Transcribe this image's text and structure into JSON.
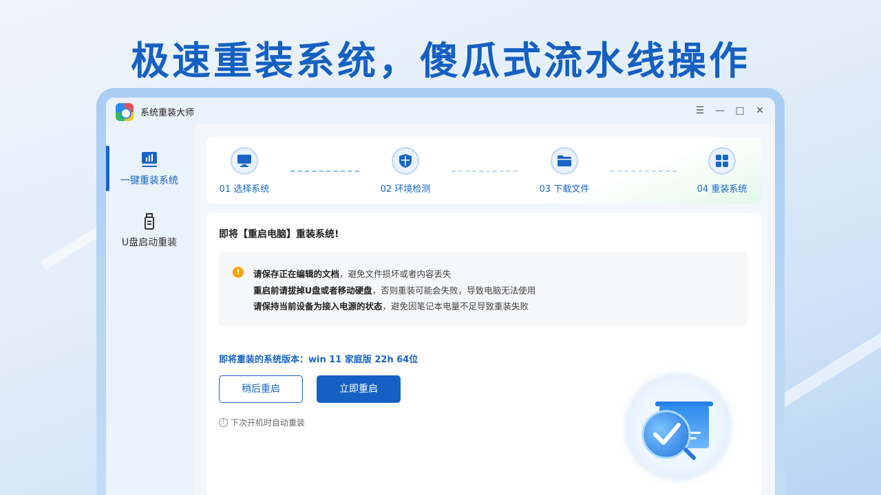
{
  "hero": {
    "title": "极速重装系统，傻瓜式流水线操作"
  },
  "app": {
    "title": "系统重装大师",
    "controls": {
      "menu": "☰",
      "minimize": "—",
      "maximize": "□",
      "close": "✕"
    }
  },
  "sidebar": {
    "items": [
      {
        "label": "一键重装系统",
        "icon": "chart-monitor-icon",
        "active": true
      },
      {
        "label": "U盘启动重装",
        "icon": "usb-drive-icon",
        "active": false
      }
    ]
  },
  "steps": [
    {
      "label": "01 选择系统",
      "icon": "monitor-icon"
    },
    {
      "label": "02 环境检测",
      "icon": "shield-icon"
    },
    {
      "label": "03 下载文件",
      "icon": "folder-icon"
    },
    {
      "label": "04 重装系统",
      "icon": "windows-icon"
    }
  ],
  "content": {
    "heading": "即将【重启电脑】重装系统!",
    "tips": [
      {
        "bold": "请保存正在编辑的文档",
        "rest": "，避免文件损坏或者内容丢失"
      },
      {
        "bold": "重启前请拔掉U盘或者移动硬盘",
        "rest": "，否则重装可能会失败，导致电脑无法使用"
      },
      {
        "bold": "请保持当前设备为接入电源的状态",
        "rest": "，避免因笔记本电量不足导致重装失败"
      }
    ],
    "version_line": "即将重装的系统版本：win 11 家庭版 22h 64位",
    "btn_later": "稍后重启",
    "btn_now": "立即重启",
    "auto_note": "下次开机时自动重装"
  },
  "colors": {
    "accent": "#1560c2",
    "warning": "#f7a400"
  }
}
